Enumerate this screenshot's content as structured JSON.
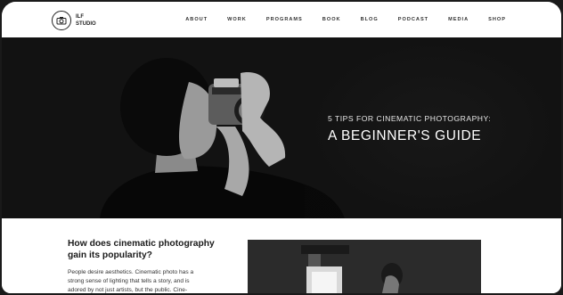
{
  "header": {
    "logo_line1": "ILF",
    "logo_line2": "STUDIO",
    "nav": [
      "ABOUT",
      "WORK",
      "PROGRAMS",
      "BOOK",
      "BLOG",
      "PODCAST",
      "MEDIA",
      "SHOP"
    ]
  },
  "hero": {
    "subtitle": "5 TIPS FOR CINEMATIC PHOTOGRAPHY:",
    "title": "A BEGINNER'S GUIDE"
  },
  "article": {
    "heading": "How does cinematic photography gain its popularity?",
    "body_line1": "People desire aesthetics. Cinematic photo has a",
    "body_line2": "strong sense of lighting that tells a story, and is",
    "body_line3": "adored by not just artists, but the public. Cine-"
  },
  "colors": {
    "hero_bg": "#121212",
    "page_bg": "#ffffff",
    "outer_bg": "#1a1a1a"
  }
}
